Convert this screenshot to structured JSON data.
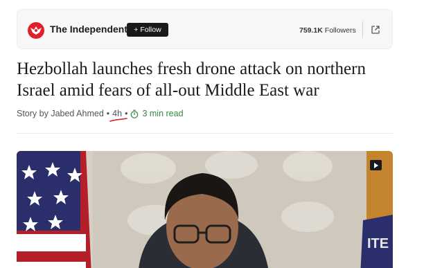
{
  "publisher": {
    "name": "The Independent",
    "follow_label": "+ Follow",
    "followers_count": "759.1K",
    "followers_label": "Followers",
    "logo_color": "#e0202a"
  },
  "article": {
    "headline": "Hezbollah launches fresh drone attack on northern Israel amid fears of all-out Middle East war",
    "byline_prefix": "Story by Jabed Ahmed",
    "separator": "•",
    "age": "4h",
    "read_time": "3 min read",
    "read_time_color": "#2e8b3d"
  },
  "media": {
    "type": "video",
    "badge_icon": "play-icon"
  },
  "icons": {
    "share": "external-share-icon",
    "timer": "timer-icon",
    "logo": "eagle-logo-icon"
  }
}
